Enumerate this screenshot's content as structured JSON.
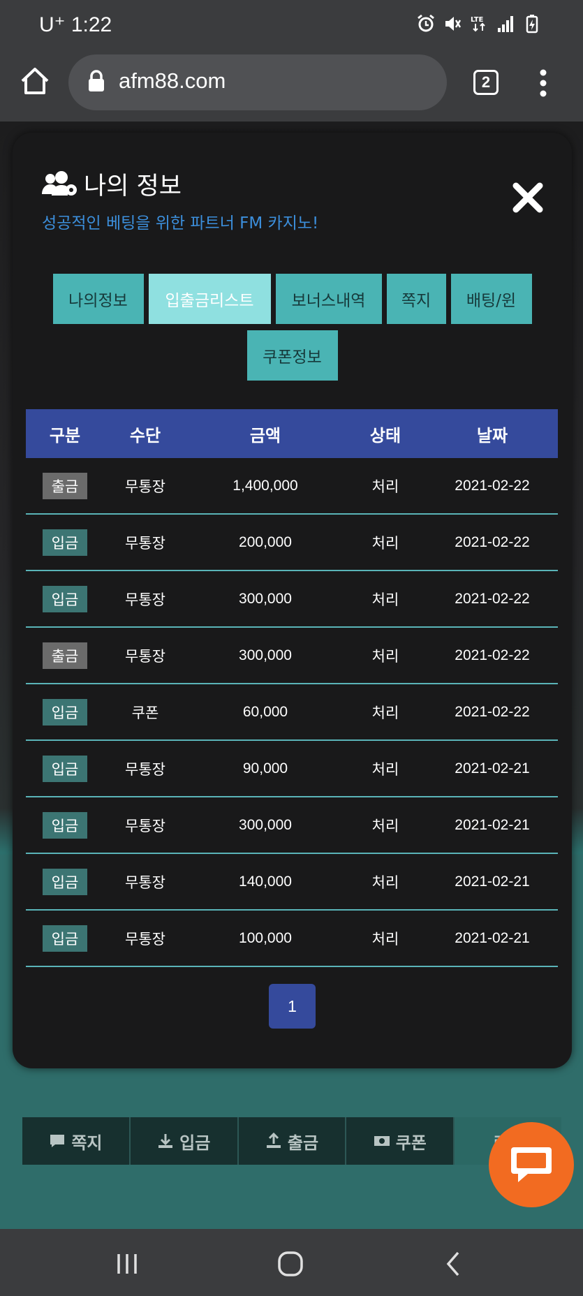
{
  "status_bar": {
    "carrier": "U⁺ 1:22"
  },
  "browser": {
    "url": "afm88.com",
    "tab_count": "2"
  },
  "modal": {
    "title": "나의 정보",
    "subtitle": "성공적인 베팅을 위한 파트너 FM 카지노!",
    "tabs": [
      {
        "label": "나의정보",
        "active": false
      },
      {
        "label": "입출금리스트",
        "active": true
      },
      {
        "label": "보너스내역",
        "active": false
      },
      {
        "label": "쪽지",
        "active": false
      },
      {
        "label": "배팅/윈",
        "active": false
      },
      {
        "label": "쿠폰정보",
        "active": false
      }
    ],
    "table": {
      "headers": [
        "구분",
        "수단",
        "금액",
        "상태",
        "날짜"
      ],
      "rows": [
        {
          "type": "출금",
          "method": "무통장",
          "amount": "1,400,000",
          "status": "처리",
          "date": "2021-02-22"
        },
        {
          "type": "입금",
          "method": "무통장",
          "amount": "200,000",
          "status": "처리",
          "date": "2021-02-22"
        },
        {
          "type": "입금",
          "method": "무통장",
          "amount": "300,000",
          "status": "처리",
          "date": "2021-02-22"
        },
        {
          "type": "출금",
          "method": "무통장",
          "amount": "300,000",
          "status": "처리",
          "date": "2021-02-22"
        },
        {
          "type": "입금",
          "method": "쿠폰",
          "amount": "60,000",
          "status": "처리",
          "date": "2021-02-22"
        },
        {
          "type": "입금",
          "method": "무통장",
          "amount": "90,000",
          "status": "처리",
          "date": "2021-02-21"
        },
        {
          "type": "입금",
          "method": "무통장",
          "amount": "300,000",
          "status": "처리",
          "date": "2021-02-21"
        },
        {
          "type": "입금",
          "method": "무통장",
          "amount": "140,000",
          "status": "처리",
          "date": "2021-02-21"
        },
        {
          "type": "입금",
          "method": "무통장",
          "amount": "100,000",
          "status": "처리",
          "date": "2021-02-21"
        }
      ]
    },
    "pager": {
      "current": "1"
    }
  },
  "bottom_menu": {
    "items": [
      {
        "label": "쪽지",
        "icon": "message-icon"
      },
      {
        "label": "입금",
        "icon": "download-icon"
      },
      {
        "label": "출금",
        "icon": "upload-icon"
      },
      {
        "label": "쿠폰",
        "icon": "coupon-icon"
      },
      {
        "label": "로그",
        "icon": ""
      }
    ]
  },
  "colors": {
    "accent_tab": "#4ab4b4",
    "active_tab": "#8fe0e0",
    "table_header": "#354a9c",
    "subtitle": "#3c8fdc",
    "chat_button": "#f26b21"
  }
}
